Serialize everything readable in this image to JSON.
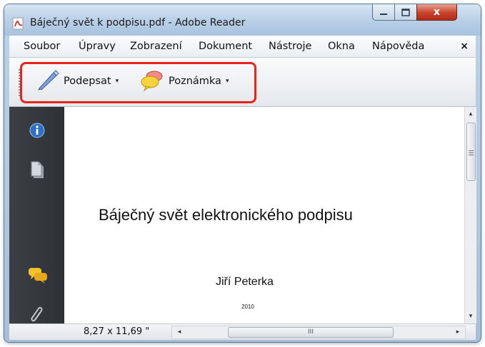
{
  "window": {
    "title": "Báječný svět k podpisu.pdf - Adobe Reader",
    "app_icon": "adobe-reader-icon",
    "controls": [
      "minimize-icon",
      "maximize-icon",
      "close-icon"
    ],
    "close_glyph": "x"
  },
  "menu": {
    "items": [
      "Soubor",
      "Úpravy",
      "Zobrazení",
      "Dokument",
      "Nástroje",
      "Okna",
      "Nápověda"
    ],
    "close_glyph": "×"
  },
  "toolbar": {
    "sign_label": "Podepsat",
    "sign_icon": "pen-icon",
    "comment_label": "Poznámka",
    "comment_icon": "speech-bubbles-icon",
    "caret": "▾",
    "highlight_color": "#e8231a"
  },
  "navigation_pane": {
    "icons": [
      "info-icon",
      "pages-icon",
      "comments-icon",
      "attachment-icon"
    ]
  },
  "document": {
    "title": "Báječný svět elektronického podpisu",
    "author": "Jiří Peterka",
    "year": "2010"
  },
  "status": {
    "page_size": "8,27 x 11,69 \"",
    "hscroll_grip": "III",
    "left_arrow": "◂",
    "right_arrow": "▸",
    "up_arrow": "▴",
    "down_arrow": "▾"
  }
}
